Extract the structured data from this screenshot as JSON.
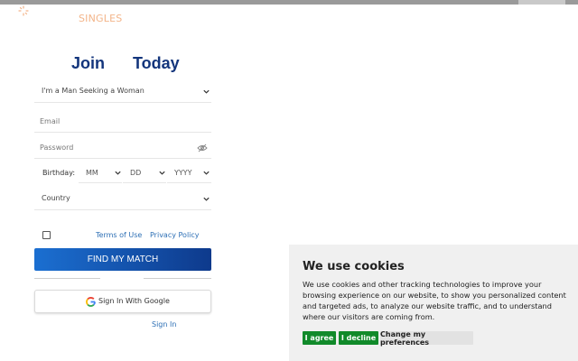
{
  "brand": {
    "logo_text": "SINGLES"
  },
  "hero": {
    "word1": "Join",
    "word2": "Today"
  },
  "form": {
    "seeking_select": "I'm a Man Seeking a Woman",
    "email_placeholder": "Email",
    "password_placeholder": "Password",
    "birthday_label": "Birthday:",
    "birthday": {
      "month": "MM",
      "day": "DD",
      "year": "YYYY"
    },
    "country_select": "Country",
    "terms_link": "Terms of Use",
    "privacy_link": "Privacy Policy",
    "submit_label": "FIND MY MATCH",
    "google_label": "Sign In With Google",
    "signin_link": "Sign In"
  },
  "cookie_banner": {
    "title": "We use cookies",
    "body": "We use cookies and other tracking technologies to improve your browsing experience on our website, to show you personalized content and targeted ads, to analyze our website traffic, and to understand where our visitors are coming from.",
    "agree_label": "I agree",
    "decline_label": "I decline",
    "prefs_label": "Change my preferences"
  },
  "colors": {
    "brand_navy": "#13357c",
    "button_gradient_start": "#1b6fd1",
    "button_gradient_end": "#0e3a8c",
    "logo_accent": "#f3b58a",
    "cookie_green": "#118a2a",
    "link_blue": "#2d6fb5"
  }
}
